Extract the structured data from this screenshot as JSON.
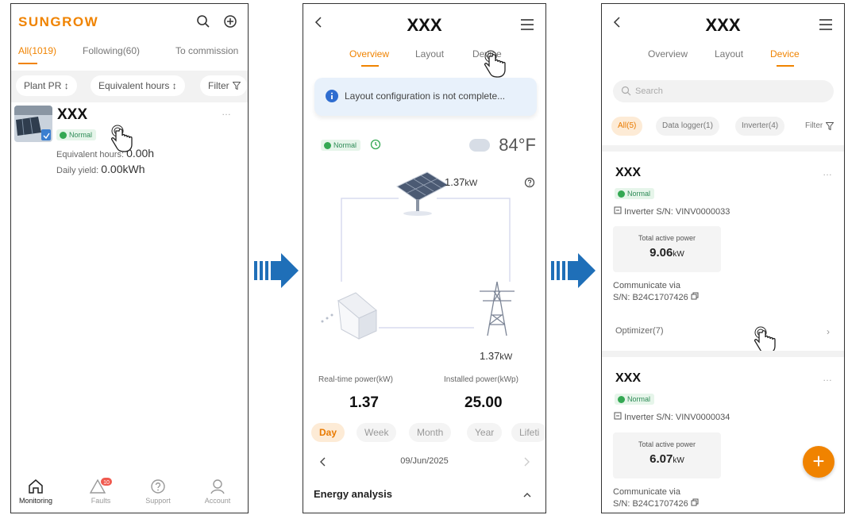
{
  "screen1": {
    "logo": "SUNGROW",
    "tabs": [
      "All(1019)",
      "Following(60)",
      "To commission"
    ],
    "filters": [
      "Plant PR ↕",
      "Equivalent hours ↕",
      "Filter"
    ],
    "plant": {
      "name": "XXX",
      "status": "Normal",
      "equivalent_hours_label": "Equivalent hours:",
      "equivalent_hours_value": "0.00h",
      "daily_yield_label": "Daily yield:",
      "daily_yield_value": "0.00kWh",
      "more": "…"
    },
    "nav": {
      "items": [
        "Monitoring",
        "Faults",
        "Support",
        "Account"
      ],
      "faults_badge": "10"
    }
  },
  "screen2": {
    "title": "XXX",
    "tabs": [
      "Overview",
      "Layout",
      "Device"
    ],
    "notice": "Layout configuration is not complete...",
    "status": "Normal",
    "temperature": "84°F",
    "pv_power": "1.37",
    "pv_unit": "kW",
    "grid_power": "1.37",
    "grid_unit": "kW",
    "realtime_label": "Real-time power(kW)",
    "realtime_value": "1.37",
    "installed_label": "Installed power(kWp)",
    "installed_value": "25.00",
    "periods": [
      "Day",
      "Week",
      "Month",
      "Year",
      "Lifeti"
    ],
    "date": "09/Jun/2025",
    "energy_analysis": "Energy analysis"
  },
  "screen3": {
    "title": "XXX",
    "tabs": [
      "Overview",
      "Layout",
      "Device"
    ],
    "search_placeholder": "Search",
    "chips": [
      "All(5)",
      "Data logger(1)",
      "Inverter(4)",
      "Filter"
    ],
    "devices": [
      {
        "name": "XXX",
        "status": "Normal",
        "sn": "Inverter S/N: VINV0000033",
        "power_label": "Total active power",
        "power_value": "9.06",
        "power_unit": "kW",
        "comm_label": "Communicate via",
        "comm_sn": "S/N: B24C1707426",
        "optimizer": "Optimizer(7)",
        "more": "…"
      },
      {
        "name": "XXX",
        "status": "Normal",
        "sn": "Inverter S/N: VINV0000034",
        "power_label": "Total active power",
        "power_value": "6.07",
        "power_unit": "kW",
        "comm_label": "Communicate via",
        "comm_sn": "S/N: B24C1707426",
        "more": "…"
      }
    ],
    "fab": "+"
  },
  "colors": {
    "accent": "#f08300",
    "normal_green": "#34a853",
    "arrow_blue": "#1f6fb8"
  }
}
